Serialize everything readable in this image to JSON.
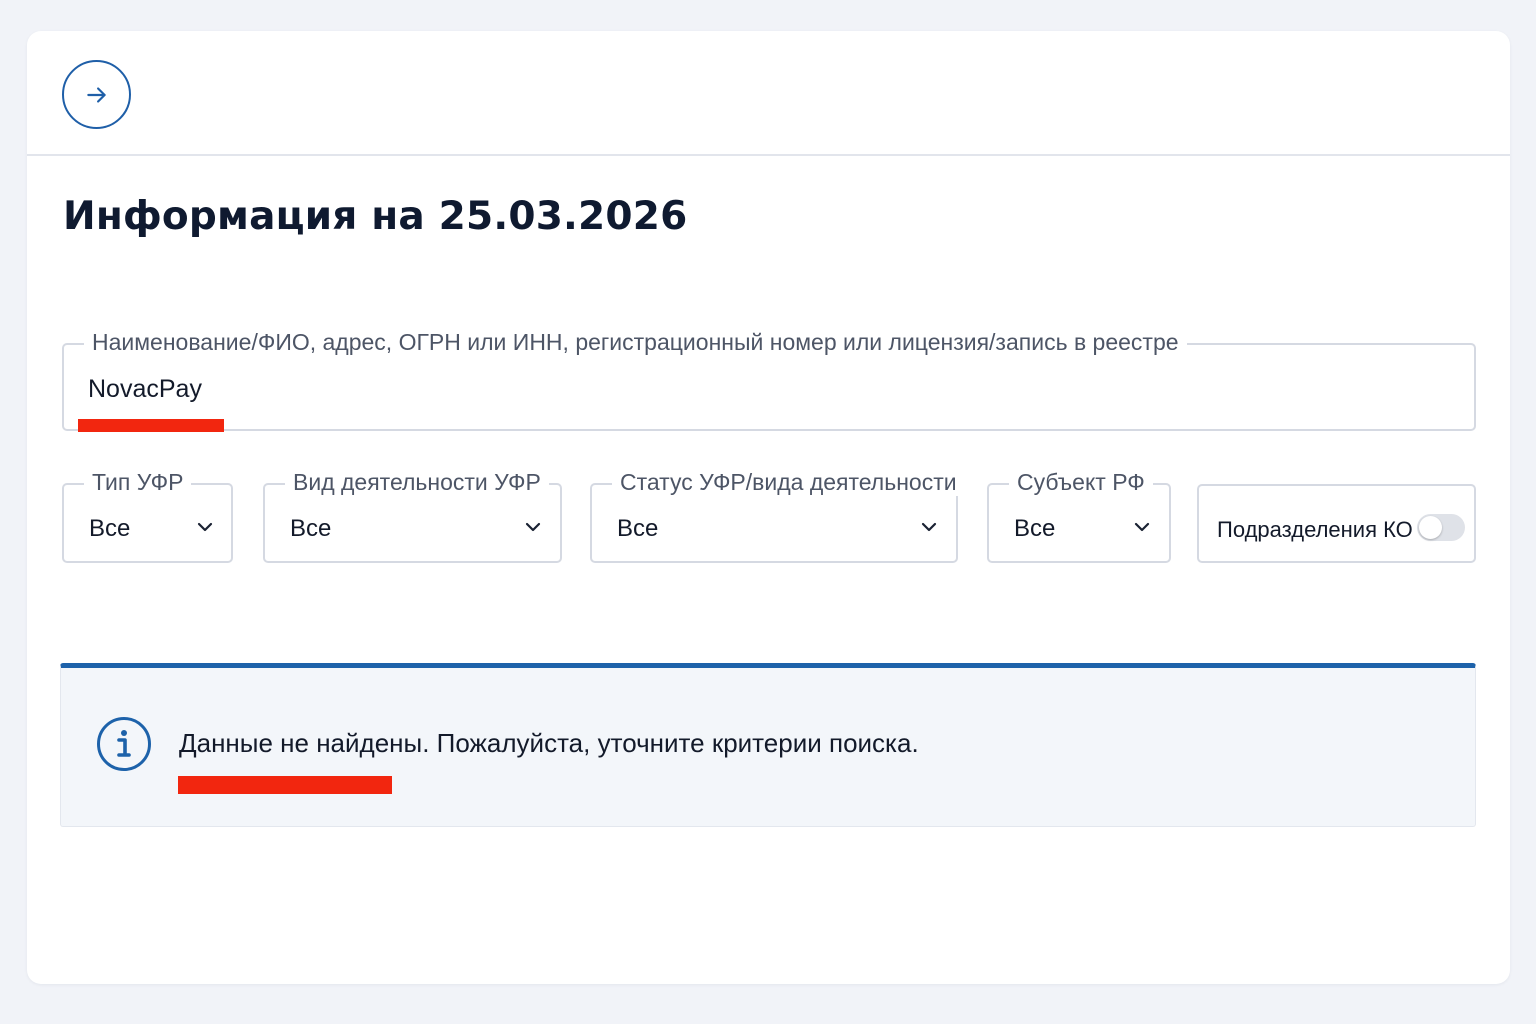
{
  "header": {
    "back_icon": "arrow-right-icon"
  },
  "page": {
    "title": "Информация на 25.03.2026"
  },
  "search": {
    "label": "Наименование/ФИО, адрес, ОГРН или ИНН, регистрационный номер или лицензия/запись в реестре",
    "value": "NovacPay"
  },
  "filters": [
    {
      "label": "Тип УФР",
      "value": "Все"
    },
    {
      "label": "Вид деятельности УФР",
      "value": "Все"
    },
    {
      "label": "Статус УФР/вида деятельности",
      "value": "Все"
    },
    {
      "label": "Субъект РФ",
      "value": "Все"
    }
  ],
  "toggle": {
    "label": "Подразделения КО",
    "checked": false
  },
  "notice": {
    "icon": "info-icon",
    "text": "Данные не найдены. Пожалуйста, уточните критерии поиска."
  },
  "colors": {
    "accent": "#1d62aa",
    "highlight": "#f2260f"
  }
}
